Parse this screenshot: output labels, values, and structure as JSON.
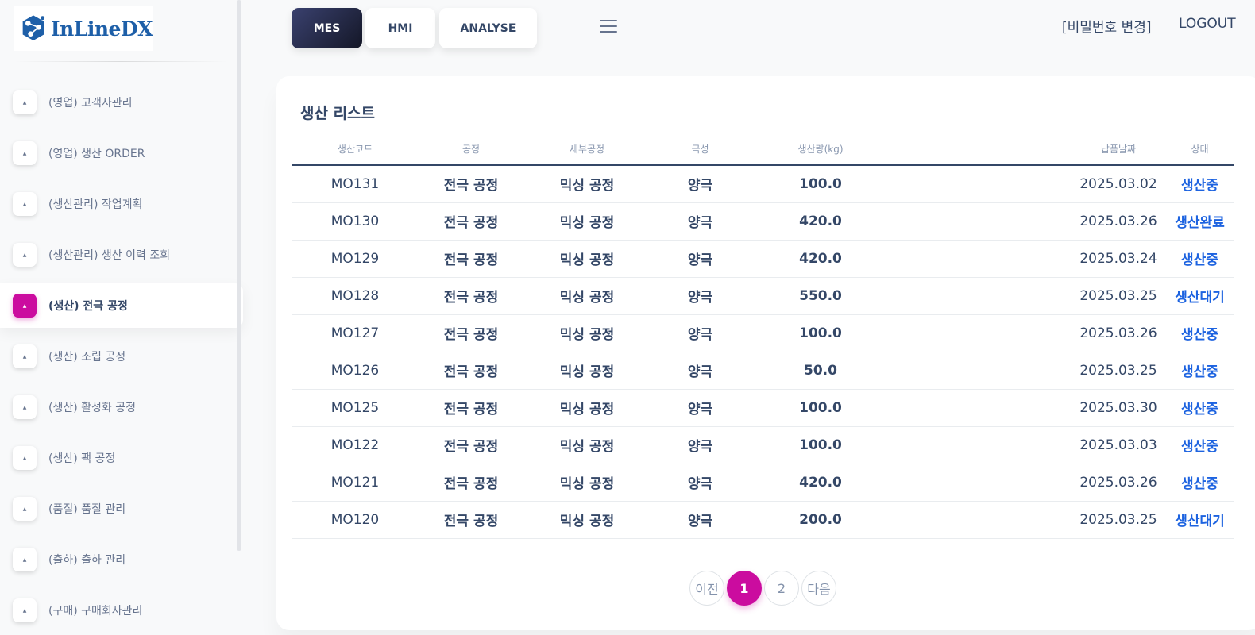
{
  "logo": {
    "text": "InLineDX"
  },
  "sidebar": {
    "items": [
      {
        "label": "(영업) 고객사관리",
        "active": false
      },
      {
        "label": "(영업) 생산 ORDER",
        "active": false
      },
      {
        "label": "(생산관리) 작업계획",
        "active": false
      },
      {
        "label": "(생산관리) 생산 이력 조회",
        "active": false
      },
      {
        "label": "(생산) 전극 공정",
        "active": true
      },
      {
        "label": "(생산) 조립 공정",
        "active": false
      },
      {
        "label": "(생산) 활성화 공정",
        "active": false
      },
      {
        "label": "(생산) 팩 공정",
        "active": false
      },
      {
        "label": "(품질) 품질 관리",
        "active": false
      },
      {
        "label": "(출하) 출하 관리",
        "active": false
      },
      {
        "label": "(구매) 구매회사관리",
        "active": false
      }
    ]
  },
  "topbar": {
    "mes_label": "MES",
    "hmi_label": "HMI",
    "analyse_label": "ANALYSE",
    "password_label": "[비밀번호 변경]",
    "logout_label": "LOGOUT"
  },
  "main": {
    "title": "생산 리스트",
    "columns": [
      "생산코드",
      "공정",
      "세부공정",
      "극성",
      "생산량(kg)",
      "",
      "납품날짜",
      "상태"
    ],
    "rows": [
      {
        "code": "MO131",
        "process": "전극 공정",
        "sub": "믹싱 공정",
        "polarity": "양극",
        "qty": "100.0",
        "date": "2025.03.02",
        "status": "생산중"
      },
      {
        "code": "MO130",
        "process": "전극 공정",
        "sub": "믹싱 공정",
        "polarity": "양극",
        "qty": "420.0",
        "date": "2025.03.26",
        "status": "생산완료"
      },
      {
        "code": "MO129",
        "process": "전극 공정",
        "sub": "믹싱 공정",
        "polarity": "양극",
        "qty": "420.0",
        "date": "2025.03.24",
        "status": "생산중"
      },
      {
        "code": "MO128",
        "process": "전극 공정",
        "sub": "믹싱 공정",
        "polarity": "양극",
        "qty": "550.0",
        "date": "2025.03.25",
        "status": "생산대기"
      },
      {
        "code": "MO127",
        "process": "전극 공정",
        "sub": "믹싱 공정",
        "polarity": "양극",
        "qty": "100.0",
        "date": "2025.03.26",
        "status": "생산중"
      },
      {
        "code": "MO126",
        "process": "전극 공정",
        "sub": "믹싱 공정",
        "polarity": "양극",
        "qty": "50.0",
        "date": "2025.03.25",
        "status": "생산중"
      },
      {
        "code": "MO125",
        "process": "전극 공정",
        "sub": "믹싱 공정",
        "polarity": "양극",
        "qty": "100.0",
        "date": "2025.03.30",
        "status": "생산중"
      },
      {
        "code": "MO122",
        "process": "전극 공정",
        "sub": "믹싱 공정",
        "polarity": "양극",
        "qty": "100.0",
        "date": "2025.03.03",
        "status": "생산중"
      },
      {
        "code": "MO121",
        "process": "전극 공정",
        "sub": "믹싱 공정",
        "polarity": "양극",
        "qty": "420.0",
        "date": "2025.03.26",
        "status": "생산중"
      },
      {
        "code": "MO120",
        "process": "전극 공정",
        "sub": "믹싱 공정",
        "polarity": "양극",
        "qty": "200.0",
        "date": "2025.03.25",
        "status": "생산대기"
      }
    ]
  },
  "pagination": {
    "prev_label": "이전",
    "pages": [
      "1",
      "2"
    ],
    "current": "1",
    "next_label": "다음"
  },
  "colors": {
    "accent": "#cb0c9f",
    "status": "#1d63e0",
    "dark": "#344767"
  }
}
